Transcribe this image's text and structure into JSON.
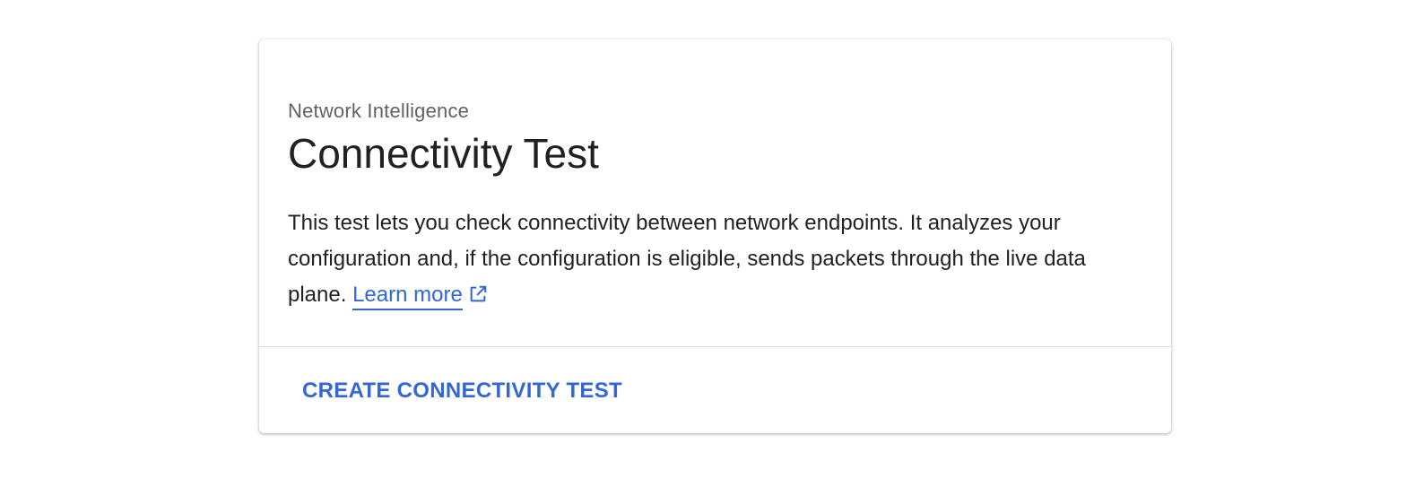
{
  "card": {
    "eyebrow": "Network Intelligence",
    "title": "Connectivity Test",
    "description": "This test lets you check connectivity between network endpoints. It analyzes your configuration and, if the configuration is eligible, sends packets through the live data plane.",
    "learn_more_label": "Learn more",
    "learn_more_icon": "open-in-new-icon",
    "action_label": "CREATE CONNECTIVITY TEST"
  },
  "colors": {
    "accent": "#3367d6",
    "text_primary": "#202124",
    "text_secondary": "#5f6368",
    "divider": "#dadce0"
  }
}
